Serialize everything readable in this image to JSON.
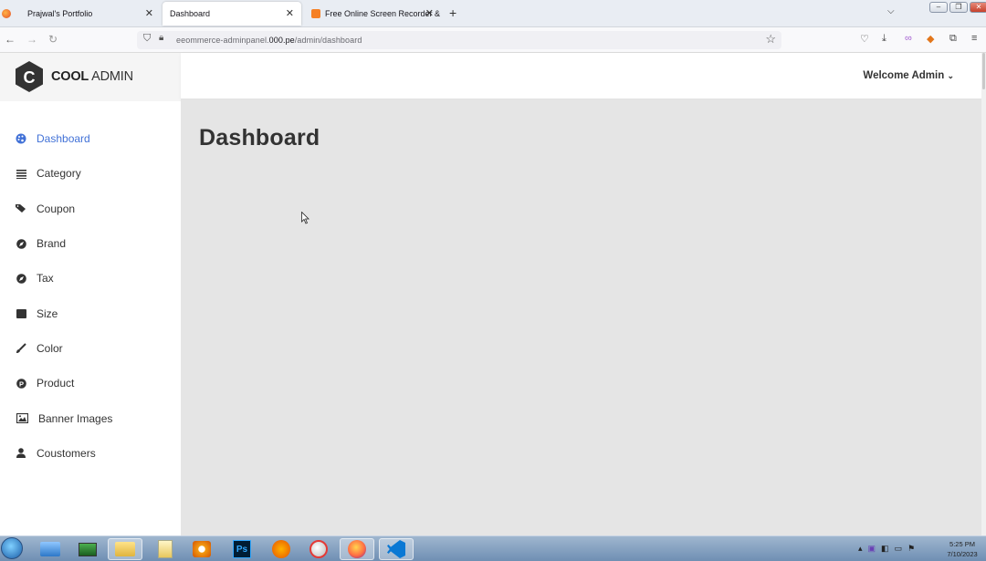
{
  "browser": {
    "tabs": [
      {
        "title": "Prajwal's Portfolio"
      },
      {
        "title": "Dashboard"
      },
      {
        "title": "Free Online Screen Recorder &"
      }
    ],
    "url_prefix": "eeommerce-adminpanel.",
    "url_domain": "000.pe",
    "url_path": "/admin/dashboard"
  },
  "app": {
    "logo": {
      "bold": "COOL",
      "regular": " ADMIN",
      "letter": "C"
    },
    "welcome": "Welcome Admin",
    "page_title": "Dashboard",
    "menu": [
      {
        "label": "Dashboard",
        "icon": "palette-icon",
        "active": true
      },
      {
        "label": "Category",
        "icon": "list-icon",
        "active": false
      },
      {
        "label": "Coupon",
        "icon": "tags-icon",
        "active": false
      },
      {
        "label": "Brand",
        "icon": "compass-icon",
        "active": false
      },
      {
        "label": "Tax",
        "icon": "compass-icon",
        "active": false
      },
      {
        "label": "Size",
        "icon": "window-icon",
        "active": false
      },
      {
        "label": "Color",
        "icon": "brush-icon",
        "active": false
      },
      {
        "label": "Product",
        "icon": "product-icon",
        "active": false
      },
      {
        "label": "Banner Images",
        "icon": "images-icon",
        "active": false
      },
      {
        "label": "Coustomers",
        "icon": "user-icon",
        "active": false
      }
    ]
  },
  "taskbar": {
    "clock_time": "5:25 PM",
    "clock_date": "7/10/2023",
    "items": [
      "explorer-icon",
      "monitor-icon",
      "folder-icon",
      "notepad-icon",
      "media-player-icon",
      "photoshop-icon",
      "fl-studio-icon",
      "paint-icon",
      "firefox-icon",
      "vscode-icon"
    ],
    "photoshop_label": "Ps"
  },
  "colors": {
    "accent": "#4272d7",
    "main_bg": "#e5e5e5"
  }
}
